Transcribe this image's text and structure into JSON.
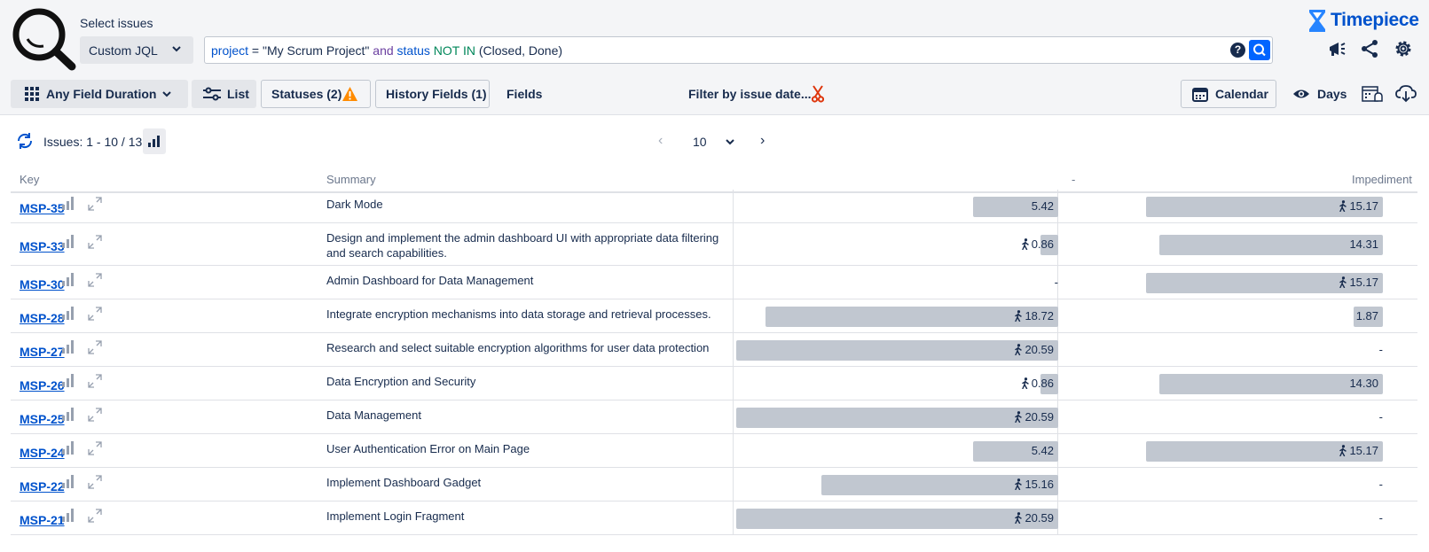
{
  "header": {
    "select_label": "Select issues",
    "jql_mode": "Custom JQL",
    "query": {
      "field1": "project",
      "op1": " = ",
      "value1": "\"My Scrum Project\"",
      "kw_and": " and ",
      "field2": "status",
      "kw_not_in": " NOT IN",
      "value2": " (Closed, Done)"
    },
    "help_glyph": "?",
    "brand": "Timepiece"
  },
  "toolbar": {
    "report_type": "Any Field Duration",
    "list_label": "List",
    "statuses_label": "Statuses (2)",
    "history_fields_label": "History Fields (1)",
    "fields_label": "Fields",
    "filter_by_date_label": "Filter by issue date...",
    "calendar_label": "Calendar",
    "days_label": "Days"
  },
  "pagination": {
    "issues_text": "Issues: 1 - 10 / 13",
    "page_size": "10"
  },
  "table": {
    "headers": {
      "key": "Key",
      "summary": "Summary",
      "col1": "-",
      "col2": "Impediment"
    },
    "max_value": 20.59,
    "rows": [
      {
        "key": "MSP-35",
        "summary": "Dark Mode",
        "col1": 5.42,
        "col1_text": "5.42",
        "col1_icon": false,
        "col2": 15.17,
        "col2_text": "15.17",
        "col2_icon": true
      },
      {
        "key": "MSP-33",
        "summary": "Design and implement the admin dashboard UI with appropriate data filtering and search capabilities.",
        "col1": 0.86,
        "col1_text": "0.86",
        "col1_icon": true,
        "col2": 14.31,
        "col2_text": "14.31",
        "col2_icon": false
      },
      {
        "key": "MSP-30",
        "summary": "Admin Dashboard for Data Management",
        "col1": null,
        "col1_text": "-",
        "col1_icon": false,
        "col2": 15.17,
        "col2_text": "15.17",
        "col2_icon": true
      },
      {
        "key": "MSP-28",
        "summary": "Integrate encryption mechanisms into data storage and retrieval processes.",
        "col1": 18.72,
        "col1_text": "18.72",
        "col1_icon": true,
        "col2": 1.87,
        "col2_text": "1.87",
        "col2_icon": false
      },
      {
        "key": "MSP-27",
        "summary": "Research and select suitable encryption algorithms for user data protection",
        "col1": 20.59,
        "col1_text": "20.59",
        "col1_icon": true,
        "col2": null,
        "col2_text": "-",
        "col2_icon": false
      },
      {
        "key": "MSP-26",
        "summary": "Data Encryption and Security",
        "col1": 0.86,
        "col1_text": "0.86",
        "col1_icon": true,
        "col2": 14.3,
        "col2_text": "14.30",
        "col2_icon": false
      },
      {
        "key": "MSP-25",
        "summary": "Data Management",
        "col1": 20.59,
        "col1_text": "20.59",
        "col1_icon": true,
        "col2": null,
        "col2_text": "-",
        "col2_icon": false
      },
      {
        "key": "MSP-24",
        "summary": "User Authentication Error on Main Page",
        "col1": 5.42,
        "col1_text": "5.42",
        "col1_icon": false,
        "col2": 15.17,
        "col2_text": "15.17",
        "col2_icon": true
      },
      {
        "key": "MSP-22",
        "summary": "Implement Dashboard Gadget",
        "col1": 15.16,
        "col1_text": "15.16",
        "col1_icon": true,
        "col2": null,
        "col2_text": "-",
        "col2_icon": false
      },
      {
        "key": "MSP-21",
        "summary": "Implement Login Fragment",
        "col1": 20.59,
        "col1_text": "20.59",
        "col1_icon": true,
        "col2": null,
        "col2_text": "-",
        "col2_icon": false
      }
    ]
  },
  "colors": {
    "accent": "#0052cc",
    "bar": "#c1c7d0",
    "warning": "#ff8b00",
    "scissors": "#de350b"
  }
}
